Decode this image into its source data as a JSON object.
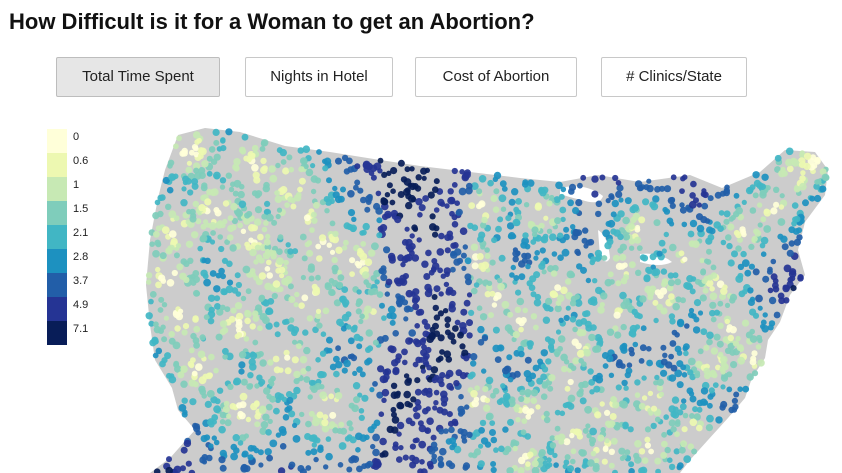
{
  "page": {
    "title": "How Difficult is it for a Woman to get an Abortion?"
  },
  "tabs": [
    {
      "label": "Total Time Spent",
      "active": true
    },
    {
      "label": "Nights in Hotel",
      "active": false
    },
    {
      "label": "Cost of Abortion",
      "active": false
    },
    {
      "label": "# Clinics/State",
      "active": false
    }
  ],
  "legend": {
    "items": [
      {
        "label": "0",
        "color": "#ffffd9"
      },
      {
        "label": "0.6",
        "color": "#edf8b1"
      },
      {
        "label": "1",
        "color": "#c7e9b4"
      },
      {
        "label": "1.5",
        "color": "#7fcdbb"
      },
      {
        "label": "2.1",
        "color": "#41b6c4"
      },
      {
        "label": "2.8",
        "color": "#1d91c0"
      },
      {
        "label": "3.7",
        "color": "#225ea8"
      },
      {
        "label": "4.9",
        "color": "#253494"
      },
      {
        "label": "7.1",
        "color": "#081d58"
      }
    ]
  },
  "map": {
    "land_color": "#cccccc",
    "clinic_hubs_value_scale": "0 = at clinic, 7.1 = max",
    "east_base_level": 4.9,
    "west_base_level": 3.7
  }
}
